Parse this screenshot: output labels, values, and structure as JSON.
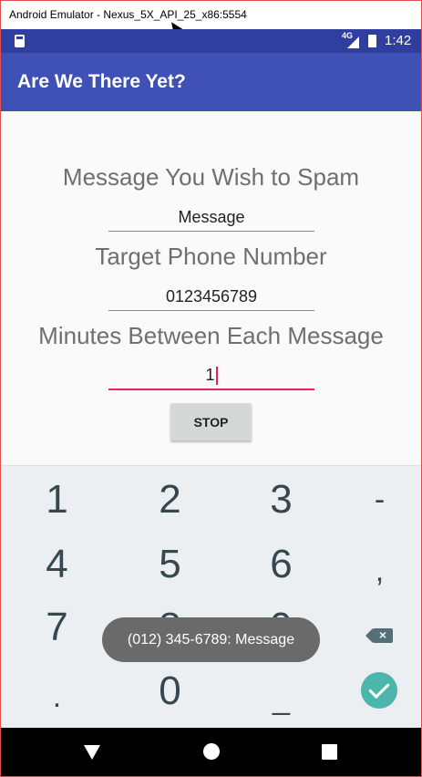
{
  "window": {
    "title": "Android Emulator - Nexus_5X_API_25_x86:5554"
  },
  "status_bar": {
    "time": "1:42",
    "network": "4G"
  },
  "app_bar": {
    "title": "Are We There Yet?"
  },
  "form": {
    "message_label": "Message You Wish to Spam",
    "message_value": "Message",
    "phone_label": "Target Phone Number",
    "phone_value": "0123456789",
    "minutes_label": "Minutes Between Each Message",
    "minutes_value": "1",
    "stop_button": "STOP"
  },
  "keypad": {
    "keys": [
      "1",
      "2",
      "3",
      "-",
      "4",
      "5",
      "6",
      ",",
      "7",
      "8",
      "9",
      ".",
      "0",
      "_"
    ]
  },
  "toast": {
    "text": "(012) 345-6789: Message"
  },
  "colors": {
    "status_bar": "#303f9f",
    "app_bar": "#3f51b5",
    "accent": "#e91e63",
    "done": "#4db6ac"
  }
}
